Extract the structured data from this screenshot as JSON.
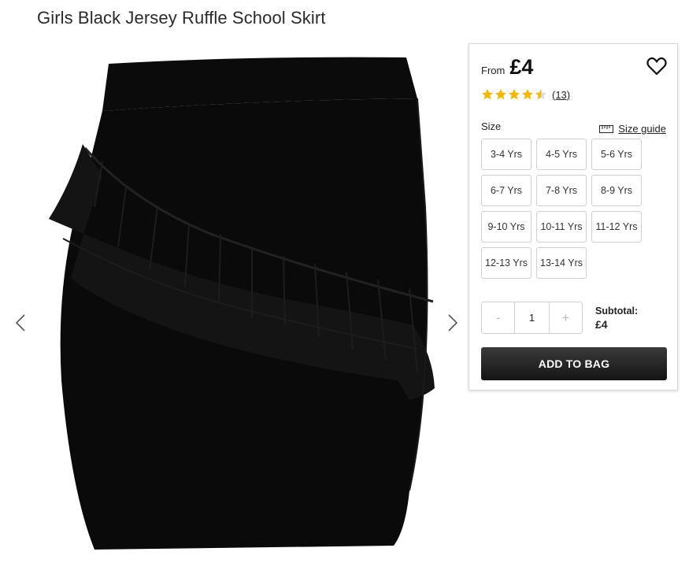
{
  "product": {
    "title": "Girls Black Jersey Ruffle School Skirt"
  },
  "gallery": {
    "image_alt": "skirt-image",
    "prev_icon": "chevron-left-icon",
    "next_icon": "chevron-right-icon"
  },
  "pricing": {
    "from_label": "From",
    "price": "£4"
  },
  "rating": {
    "stars": 4.5,
    "review_count_label": "(13)",
    "star_color": "#f5b800"
  },
  "sizes": {
    "label": "Size",
    "guide_label": "Size guide",
    "options": [
      "3-4 Yrs",
      "4-5 Yrs",
      "5-6 Yrs",
      "6-7 Yrs",
      "7-8 Yrs",
      "8-9 Yrs",
      "9-10 Yrs",
      "10-11 Yrs",
      "11-12 Yrs",
      "12-13 Yrs",
      "13-14 Yrs"
    ]
  },
  "quantity": {
    "minus": "-",
    "value": "1",
    "plus": "+"
  },
  "subtotal": {
    "label": "Subtotal:",
    "value": "£4"
  },
  "actions": {
    "add_to_bag": "ADD TO BAG"
  }
}
